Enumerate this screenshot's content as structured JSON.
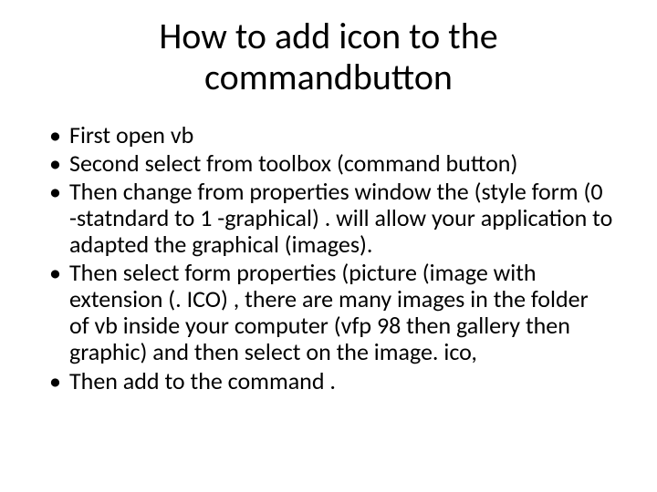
{
  "title": "How to add icon to the commandbutton",
  "bullets": [
    "First open vb",
    "Second select from toolbox (command button)",
    "Then change from properties window the (style form (0 -statndard to 1 -graphical) . will allow your application to adapted the graphical (images).",
    "Then select form properties (picture (image with extension (. ICO) , there are many images in the folder of vb inside your computer (vfp 98 then gallery then graphic) and then select on the image. ico,",
    "Then add to the command ."
  ]
}
